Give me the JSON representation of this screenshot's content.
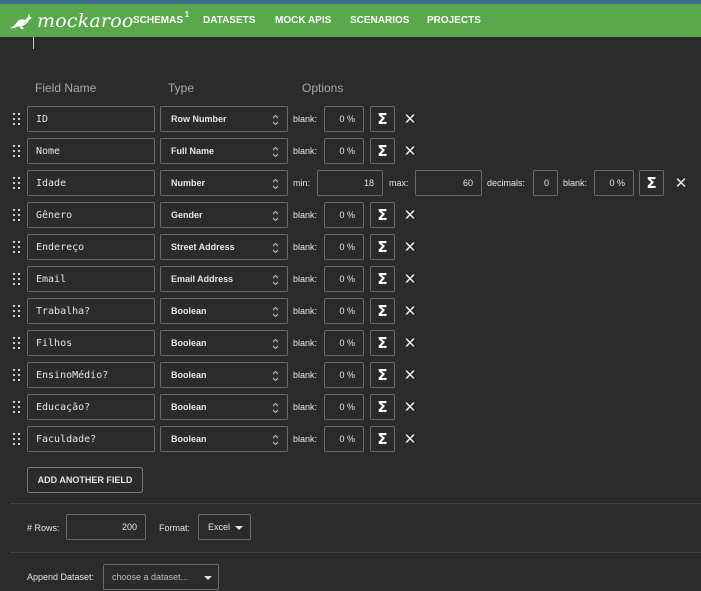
{
  "app": {
    "logo_text": "mockaroo",
    "brand_color": "#5aa84c"
  },
  "nav": {
    "items": [
      {
        "label": "SCHEMAS",
        "badge": "1"
      },
      {
        "label": "DATASETS"
      },
      {
        "label": "MOCK APIS"
      },
      {
        "label": "SCENARIOS"
      },
      {
        "label": "PROJECTS"
      }
    ]
  },
  "columns": {
    "field_name": "Field Name",
    "type": "Type",
    "options": "Options"
  },
  "fields": [
    {
      "name": "ID",
      "type": "Row Number",
      "blank_label": "blank:",
      "blank": "0 %"
    },
    {
      "name": "Nome",
      "type": "Full Name",
      "blank_label": "blank:",
      "blank": "0 %"
    },
    {
      "name": "Idade",
      "type": "Number",
      "min_label": "min:",
      "min": "18",
      "max_label": "max:",
      "max": "60",
      "decimals_label": "decimals:",
      "decimals": "0",
      "blank_label": "blank:",
      "blank": "0 %"
    },
    {
      "name": "Gênero",
      "type": "Gender",
      "blank_label": "blank:",
      "blank": "0 %"
    },
    {
      "name": "Endereço",
      "type": "Street Address",
      "blank_label": "blank:",
      "blank": "0 %"
    },
    {
      "name": "Email",
      "type": "Email Address",
      "blank_label": "blank:",
      "blank": "0 %"
    },
    {
      "name": "Trabalha?",
      "type": "Boolean",
      "blank_label": "blank:",
      "blank": "0 %"
    },
    {
      "name": "Filhos",
      "type": "Boolean",
      "blank_label": "blank:",
      "blank": "0 %"
    },
    {
      "name": "EnsinoMédio?",
      "type": "Boolean",
      "blank_label": "blank:",
      "blank": "0 %"
    },
    {
      "name": "Educação?",
      "type": "Boolean",
      "blank_label": "blank:",
      "blank": "0 %"
    },
    {
      "name": "Faculdade?",
      "type": "Boolean",
      "blank_label": "blank:",
      "blank": "0 %"
    }
  ],
  "icons": {
    "formula": "Σ",
    "remove": "✕",
    "drag": "drag-handle-icon"
  },
  "actions": {
    "add_field": "ADD ANOTHER FIELD"
  },
  "settings": {
    "rows_label": "# Rows:",
    "rows_value": "200",
    "format_label": "Format:",
    "format_value": "Excel",
    "append_label": "Append Dataset:",
    "append_placeholder": "choose a dataset..."
  }
}
